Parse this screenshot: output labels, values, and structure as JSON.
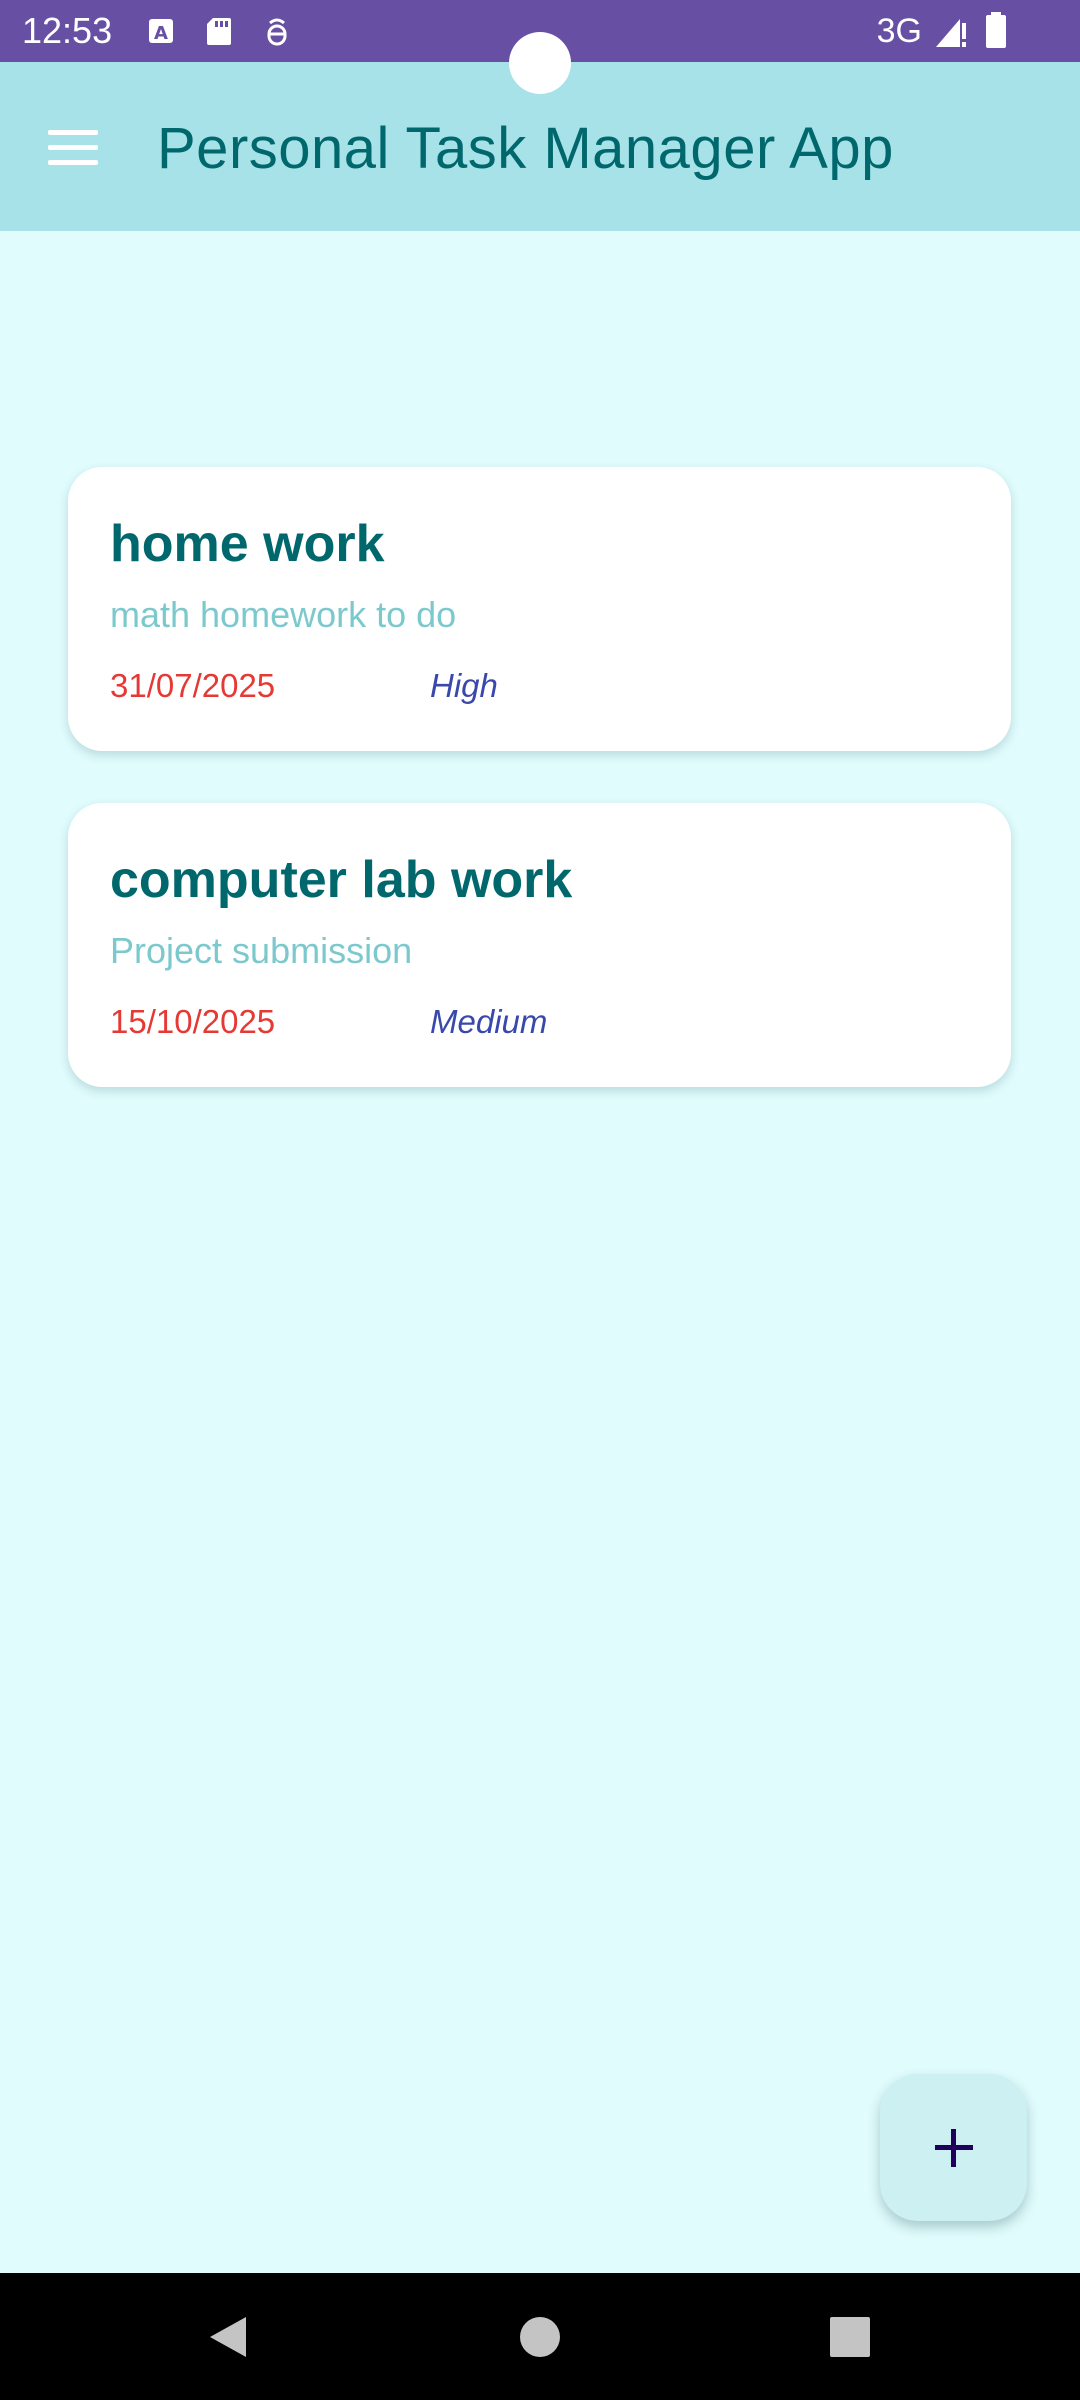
{
  "status_bar": {
    "time": "12:53",
    "network": "3G",
    "icons": [
      "keyboard-a-icon",
      "sd-card-icon",
      "debug-icon",
      "signal-icon",
      "battery-icon"
    ]
  },
  "app_bar": {
    "title": "Personal Task Manager App",
    "menu_icon": "menu-icon"
  },
  "tasks": [
    {
      "title": "home work",
      "description": "math homework to do",
      "due_date": "31/07/2025",
      "priority": "High"
    },
    {
      "title": "computer lab work",
      "description": "Project submission",
      "due_date": "15/10/2025",
      "priority": "Medium"
    }
  ],
  "fab": {
    "icon": "plus-icon"
  },
  "nav_bar": {
    "icons": [
      "back-icon",
      "home-icon",
      "recents-icon"
    ]
  },
  "colors": {
    "status_bar": "#6750a4",
    "app_bar": "#a6e2e8",
    "background": "#e0fcfd",
    "title_text": "#00686c",
    "description_text": "#7cc9cd",
    "date_text": "#e53935",
    "priority_text": "#3949ab"
  }
}
